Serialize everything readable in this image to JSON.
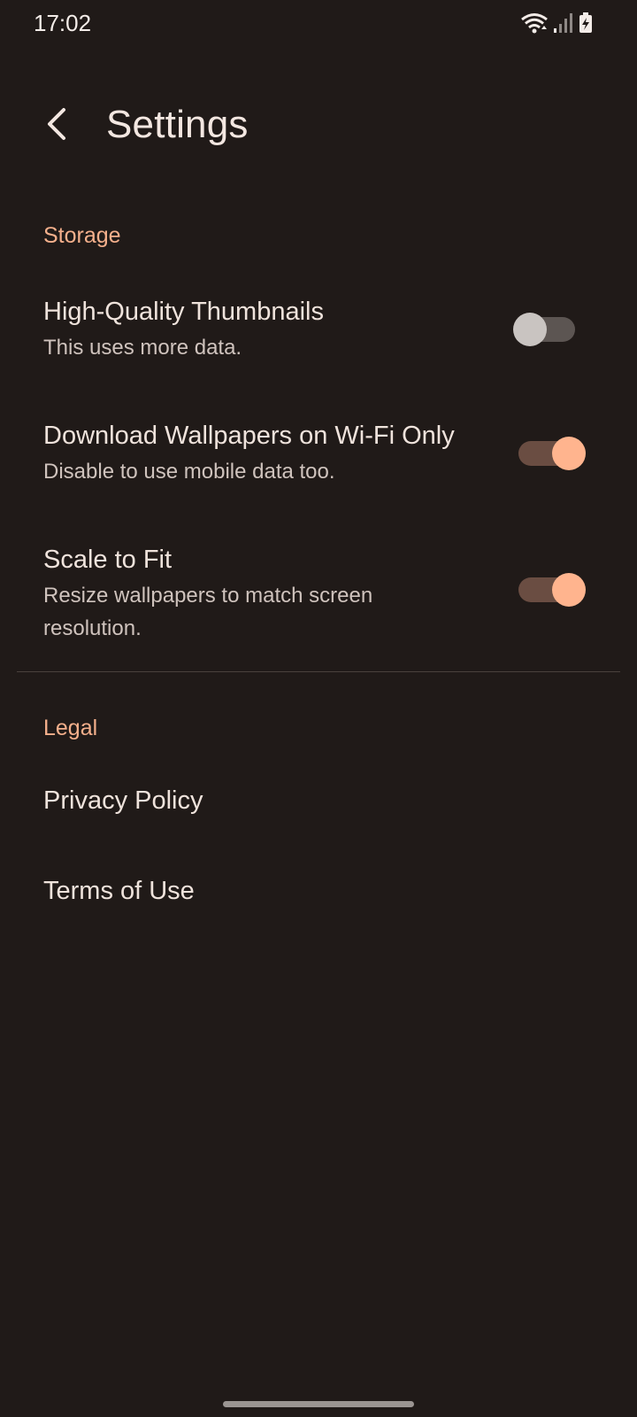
{
  "status_bar": {
    "time": "17:02",
    "icons": [
      "wifi-icon",
      "signal-icon",
      "battery-charging-icon"
    ]
  },
  "header": {
    "back_icon": "chevron-left-icon",
    "title": "Settings"
  },
  "sections": {
    "storage": {
      "header": "Storage",
      "items": [
        {
          "title": "High-Quality Thumbnails",
          "summary": "This uses more data.",
          "toggle_on": false
        },
        {
          "title": "Download Wallpapers on Wi-Fi Only",
          "summary": "Disable to use mobile data too.",
          "toggle_on": true
        },
        {
          "title": "Scale to Fit",
          "summary": "Resize wallpapers to match screen resolution.",
          "toggle_on": true
        }
      ]
    },
    "legal": {
      "header": "Legal",
      "items": [
        {
          "title": "Privacy Policy"
        },
        {
          "title": "Terms of Use"
        }
      ]
    }
  },
  "colors": {
    "background": "#201a18",
    "accent": "#ffb48e",
    "section_header": "#f5b08c",
    "text_primary": "#efe3dc",
    "text_secondary": "#cfc3bd"
  }
}
